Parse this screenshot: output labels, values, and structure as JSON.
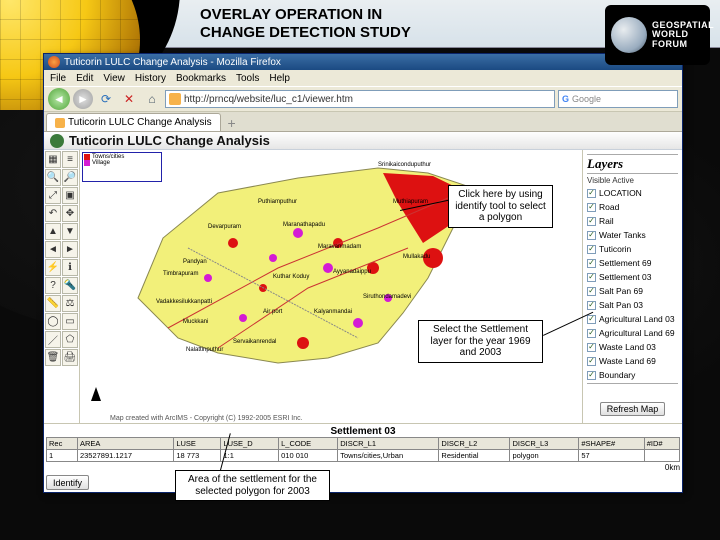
{
  "slide": {
    "title": "OVERLAY OPERATION IN\nCHANGE DETECTION STUDY"
  },
  "badge": {
    "line1": "GEOSPATIAL",
    "line2": "WORLD",
    "line3": "FORUM"
  },
  "browser": {
    "window_title": "Tuticorin LULC Change Analysis - Mozilla Firefox",
    "menu": {
      "file": "File",
      "edit": "Edit",
      "view": "View",
      "history": "History",
      "bookmarks": "Bookmarks",
      "tools": "Tools",
      "help": "Help"
    },
    "url": "http://prncq/website/luc_c1/viewer.htm",
    "search_placeholder": "Google",
    "tab": "Tuticorin LULC Change Analysis"
  },
  "page": {
    "title": "Tuticorin LULC Change Analysis",
    "copyright": "Map created with ArcIMS - Copyright (C) 1992-2005 ESRI Inc."
  },
  "layers": {
    "title": "Layers",
    "visible_label": "Visible Active",
    "items": [
      "LOCATION",
      "Road",
      "Rail",
      "Water Tanks",
      "Tuticorin",
      "Settlement 69",
      "Settlement 03",
      "Salt Pan 69",
      "Salt Pan 03",
      "Agricultural Land 03",
      "Agricultural Land 69",
      "Waste Land 03",
      "Waste Land 69",
      "Boundary"
    ],
    "refresh": "Refresh Map"
  },
  "attr": {
    "title": "Settlement 03",
    "scale": "0km",
    "headers": [
      "Rec",
      "AREA",
      "LUSE",
      "LUSE_D",
      "L_CODE",
      "DISCR_L1",
      "DISCR_L2",
      "DISCR_L3",
      "#SHAPE#",
      "#ID#"
    ],
    "row": [
      "1",
      "23527891.1217",
      "18 773",
      "1:1",
      "010 010",
      "Towns/cities,Urban",
      "Residential",
      "polygon",
      "57"
    ],
    "identify": "Identify"
  },
  "callouts": {
    "c1": "Click here by using identify tool to select a polygon",
    "c2": "Select the Settlement layer for the year 1969 and 2003",
    "c3": "Area of the settlement for the selected polygon for 2003"
  },
  "legend_thumb": {
    "a": "Towns/cities",
    "b": "Village"
  }
}
